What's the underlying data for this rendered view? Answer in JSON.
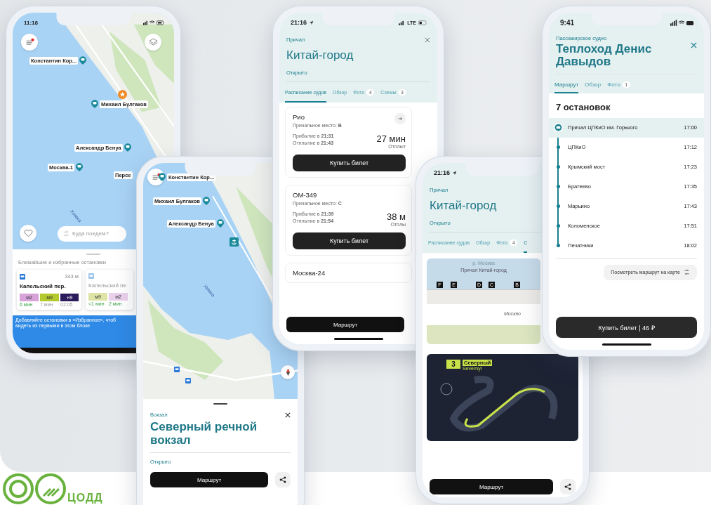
{
  "map_screen": {
    "status_time": "11:18",
    "map_labels": [
      "Константин Кор...",
      "Михаил Булгаков",
      "Александр Бенуа",
      "Москва-1",
      "Персе"
    ],
    "river_label": "Химка",
    "search": {
      "placeholder": "Куда поедем?"
    },
    "sheet_title": "Ближайшие и избранные остановки",
    "stops": [
      {
        "distance": "343 м",
        "name": "Капельский пер.",
        "faded": false,
        "routes": [
          {
            "label": "м2",
            "color": "#d7a3d9",
            "time": "6 мин",
            "live": true
          },
          {
            "label": "м9",
            "color": "#b3c92e",
            "time": "7 мин",
            "live": false
          },
          {
            "label": "н9",
            "color": "#2b1a5c",
            "time": "02:05",
            "live": false
          }
        ]
      },
      {
        "name": "Капельский пе",
        "faded": true,
        "routes": [
          {
            "label": "м9",
            "color": "#dde4a6",
            "time": "<1 мин",
            "live": true
          },
          {
            "label": "м2",
            "color": "#ebd0ec",
            "time": "2 мин",
            "live": true
          }
        ]
      }
    ],
    "banner_lines": [
      "Добавляйте остановки в «Избранное», чтоб",
      "видеть их первыми в этом блоке"
    ]
  },
  "station_screen": {
    "map_labels": [
      "Константин Кор...",
      "Михаил Булгаков",
      "Александр Бенуа"
    ],
    "river_label": "Химка",
    "category": "Вокзал",
    "title": "Северный речной вокзал",
    "status": "Открыто",
    "route_button": "Маршрут"
  },
  "pier_screen": {
    "status_time": "21:16",
    "network": "LTE",
    "category": "Причал",
    "title": "Китай-город",
    "status": "Открыто",
    "tabs": [
      {
        "label": "Расписание судов",
        "selected": true
      },
      {
        "label": "Обзор",
        "selected": false
      },
      {
        "label": "Фото",
        "count": "4",
        "selected": false
      },
      {
        "label": "Схемы",
        "count": "3",
        "selected": false
      }
    ],
    "vessels": [
      {
        "name": "Рио",
        "berth": "Причальное место: **B**",
        "details_link": true,
        "arrival": "Прибытие в **21:31**",
        "departure": "Отплытие в  **21:43**",
        "eta": "27 мин",
        "eta_label": "Отплыт",
        "button": "Купить билет"
      },
      {
        "name": "ОМ-349",
        "berth": "Причальное место: **C**",
        "details_link": false,
        "arrival": "Прибытие в **21:39**",
        "departure": "Отплытие в  **21:54**",
        "eta": "38 м",
        "eta_label": "Отплы",
        "button": "Купить билет"
      },
      {
        "name": "Москва-24"
      }
    ],
    "route_button": "Маршрут"
  },
  "schemes_screen": {
    "status_time": "21:16",
    "category": "Причал",
    "title": "Китай-город",
    "status": "Открыто",
    "tabs": [
      {
        "label": "Расписание судов",
        "selected": false
      },
      {
        "label": "Обзор",
        "selected": false
      },
      {
        "label": "Фото",
        "count": "4",
        "selected": false
      },
      {
        "label": "С",
        "selected": true
      }
    ],
    "pier_scheme": {
      "river": "р. Москва",
      "pier": "Причал Китай-город",
      "berths": [
        "F",
        "E",
        "D",
        "C",
        "B"
      ],
      "street": "Москво"
    },
    "route_map": {
      "number": "3",
      "name": "Северный",
      "subname": "Severnyi"
    },
    "route_button": "Маршрут"
  },
  "vessel_screen": {
    "status_time": "9:41",
    "category": "Пассажирское судно",
    "title": "Теплоход Денис Давыдов",
    "tabs": [
      {
        "label": "Маршрут",
        "selected": true
      },
      {
        "label": "Обзор",
        "selected": false
      },
      {
        "label": "Фото",
        "count": "1",
        "selected": false
      }
    ],
    "stops_count": "7 остановок",
    "stops": [
      {
        "name": "Причал ЦПКиО им. Горького",
        "time": "17:00",
        "current": true
      },
      {
        "name": "ЦПКиО",
        "time": "17:12",
        "current": false
      },
      {
        "name": "Крымский мост",
        "time": "17:23",
        "current": false
      },
      {
        "name": "Братеево",
        "time": "17:35",
        "current": false
      },
      {
        "name": "Марьино",
        "time": "17:43",
        "current": false
      },
      {
        "name": "Коломенское",
        "time": "17:51",
        "current": false
      },
      {
        "name": "Печатники",
        "time": "18:02",
        "current": false
      }
    ],
    "map_link": "Посмотреть маршрут на карте",
    "buy_button": "Купить билет | 46 ₽"
  },
  "logo": {
    "text": "ЦОДД"
  }
}
